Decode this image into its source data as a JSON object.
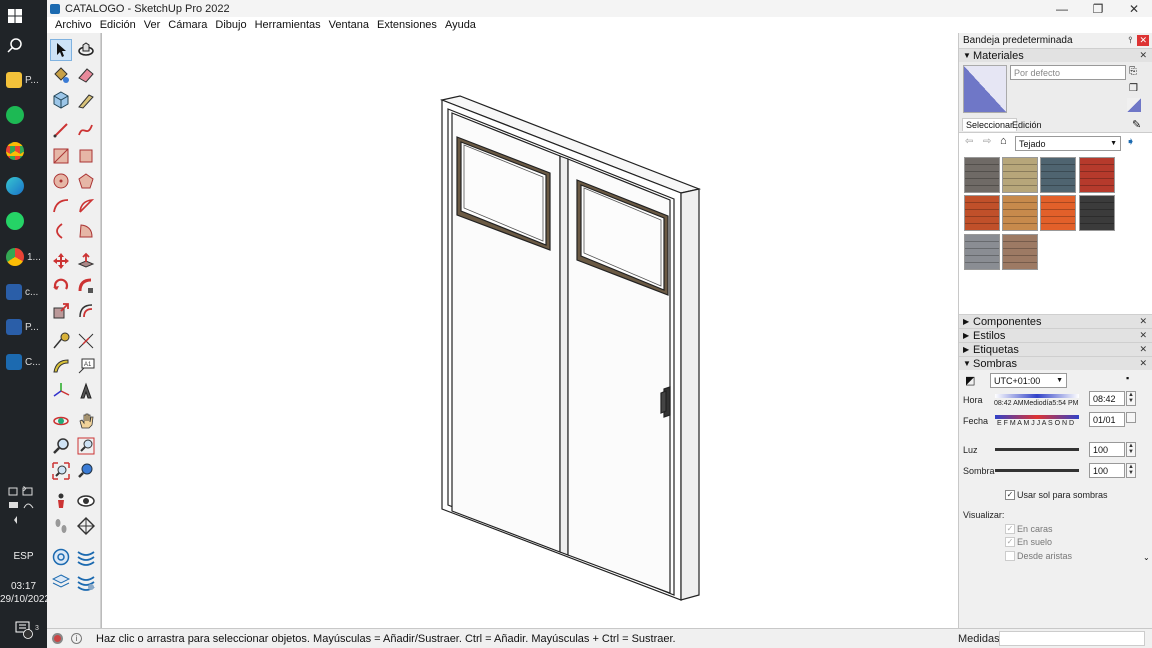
{
  "taskbar": {
    "apps": [
      {
        "icon": "windows-start-icon",
        "label": ""
      },
      {
        "icon": "search-icon",
        "label": ""
      },
      {
        "icon": "file-explorer-icon",
        "label": "P..."
      },
      {
        "icon": "spotify-icon",
        "label": ""
      },
      {
        "icon": "chrome-icon",
        "label": ""
      },
      {
        "icon": "edge-icon",
        "label": ""
      },
      {
        "icon": "whatsapp-icon",
        "label": ""
      },
      {
        "icon": "chrome-profile-icon",
        "label": "1..."
      },
      {
        "icon": "app-c-icon",
        "label": "c..."
      },
      {
        "icon": "app-p-icon",
        "label": "P..."
      },
      {
        "icon": "sketchup-icon",
        "label": "C..."
      }
    ],
    "lang": "ESP",
    "time": "03:17",
    "date": "29/10/2022",
    "notifications": "3"
  },
  "window": {
    "title": "CATALOGO - SketchUp Pro 2022",
    "minimize": "—",
    "maximize": "❐",
    "close": "✕"
  },
  "menu": [
    "Archivo",
    "Edición",
    "Ver",
    "Cámara",
    "Dibujo",
    "Herramientas",
    "Ventana",
    "Extensiones",
    "Ayuda"
  ],
  "panel": {
    "title": "Bandeja predeterminada",
    "materials": {
      "header": "Materiales",
      "name_placeholder": "Por defecto",
      "tab_select": "Seleccionar",
      "tab_edit": "Edición",
      "library": "Tejado",
      "swatch_colors": [
        "#6f6a66",
        "#b7a67a",
        "#4f6470",
        "#b63a2c",
        "#c0502a",
        "#c78a4c",
        "#e2602a",
        "#3b3b3b",
        "#8a8d93",
        "#9d7a64"
      ]
    },
    "sections": [
      "Componentes",
      "Estilos",
      "Etiquetas"
    ],
    "shadows": {
      "header": "Sombras",
      "timezone": "UTC+01:00",
      "hora_label": "Hora",
      "hora_scale": "08:42 AMMediodía5:54 PM",
      "hora_value": "08:42",
      "fecha_label": "Fecha",
      "fecha_scale": "E F M A M J J A S O N D",
      "fecha_value": "01/01",
      "luz_label": "Luz",
      "luz_value": "100",
      "sombra_label": "Sombra",
      "sombra_value": "100",
      "use_sun": "Usar sol para sombras",
      "visualizar": "Visualizar:",
      "en_caras": "En caras",
      "en_suelo": "En suelo",
      "desde_aristas": "Desde aristas"
    }
  },
  "status": {
    "hint": "Haz clic o arrastra para seleccionar objetos. Mayúsculas = Añadir/Sustraer. Ctrl = Añadir. Mayúsculas + Ctrl = Sustraer.",
    "measure_label": "Medidas"
  }
}
